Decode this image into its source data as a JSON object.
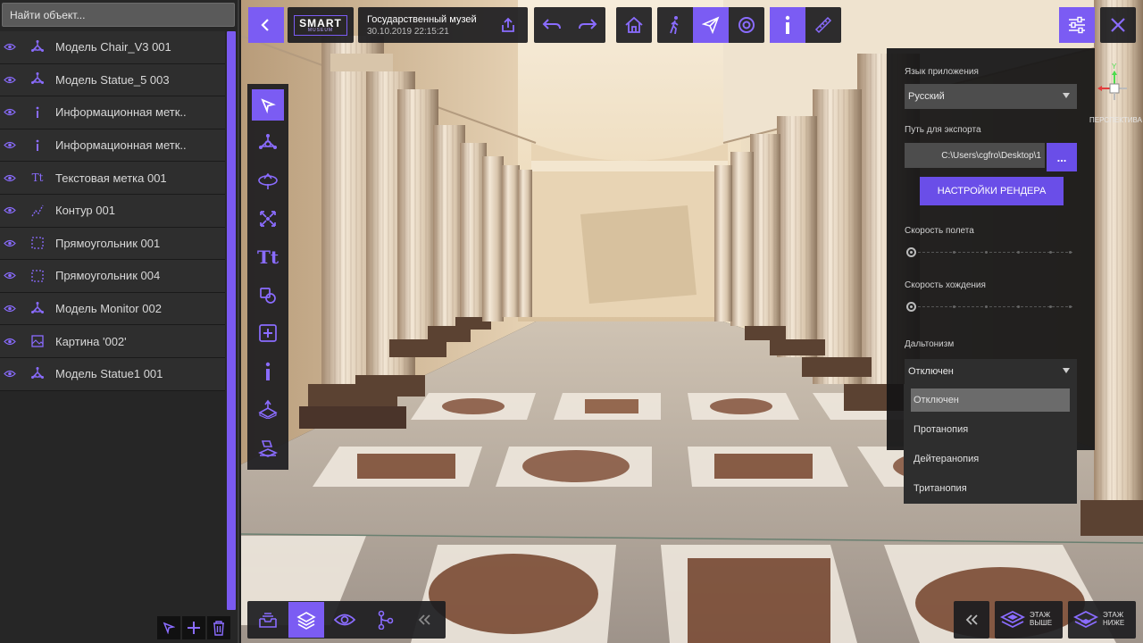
{
  "search": {
    "placeholder": "Найти объект..."
  },
  "objects": [
    {
      "icon": "model-icon",
      "label": "Модель Chair_V3 001"
    },
    {
      "icon": "model-icon",
      "label": "Модель Statue_5 003"
    },
    {
      "icon": "info-icon",
      "label": "Информационная метк.."
    },
    {
      "icon": "info-icon",
      "label": "Информационная метк.."
    },
    {
      "icon": "text-icon",
      "label": "Текстовая метка 001"
    },
    {
      "icon": "contour-icon",
      "label": "Контур 001"
    },
    {
      "icon": "rectangle-icon",
      "label": "Прямоугольник 001"
    },
    {
      "icon": "rectangle-icon",
      "label": "Прямоугольник 004"
    },
    {
      "icon": "model-icon",
      "label": "Модель Monitor 002"
    },
    {
      "icon": "picture-icon",
      "label": "Картина '002'"
    },
    {
      "icon": "model-icon",
      "label": "Модель Statue1 001"
    }
  ],
  "header": {
    "logo_top": "SMART",
    "logo_bottom": "MUSEUM",
    "project_title": "Государственный музей",
    "project_date": "30.10.2019 22:15:21"
  },
  "settings": {
    "language_label": "Язык приложения",
    "language_value": "Русский",
    "export_label": "Путь для экспорта",
    "export_path": "C:\\Users\\cgfro\\Desktop\\1",
    "browse_label": "...",
    "render_button": "НАСТРОЙКИ РЕНДЕРА",
    "flight_speed_label": "Скорость полета",
    "flight_speed_value": 0,
    "walk_speed_label": "Скорость хождения",
    "walk_speed_value": 0,
    "colorblind_label": "Дальтонизм",
    "colorblind_value": "Отключен",
    "colorblind_options": [
      "Отключен",
      "Протанопия",
      "Дейтеранопия",
      "Тританопия"
    ]
  },
  "gizmo": {
    "label": "ПЕРСПЕКТИВА",
    "y_axis": "Y"
  },
  "floor": {
    "up_line1": "ЭТАЖ",
    "up_line2": "ВЫШЕ",
    "down_line1": "ЭТАЖ",
    "down_line2": "НИЖЕ"
  },
  "colors": {
    "accent": "#7b5cf3",
    "panel": "#262626",
    "row": "#2e2e2e"
  }
}
